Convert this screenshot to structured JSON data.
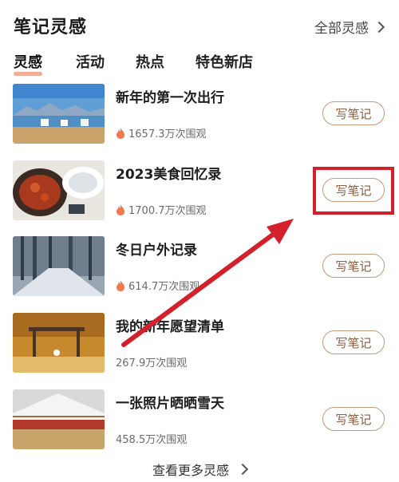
{
  "header": {
    "title": "笔记灵感",
    "all_link": "全部灵感"
  },
  "tabs": [
    {
      "label": "灵感",
      "active": true
    },
    {
      "label": "活动",
      "active": false
    },
    {
      "label": "热点",
      "active": false
    },
    {
      "label": "特色新店",
      "active": false
    }
  ],
  "items": [
    {
      "title": "新年的第一次出行",
      "views": "1657.3万次围观",
      "hot": true,
      "button": "写笔记"
    },
    {
      "title": "2023美食回忆录",
      "views": "1700.7万次围观",
      "hot": true,
      "button": "写笔记"
    },
    {
      "title": "冬日户外记录",
      "views": "614.7万次围观",
      "hot": true,
      "button": "写笔记"
    },
    {
      "title": "我的新年愿望清单",
      "views": "267.9万次围观",
      "hot": false,
      "button": "写笔记"
    },
    {
      "title": "一张照片晒晒雪天",
      "views": "458.5万次围观",
      "hot": false,
      "button": "写笔记"
    }
  ],
  "footer": {
    "more": "查看更多灵感"
  },
  "colors": {
    "accent_underline": "#f2a488",
    "button_border": "#c8987a",
    "highlight": "#d3202b",
    "fire": "#f07a4a"
  }
}
